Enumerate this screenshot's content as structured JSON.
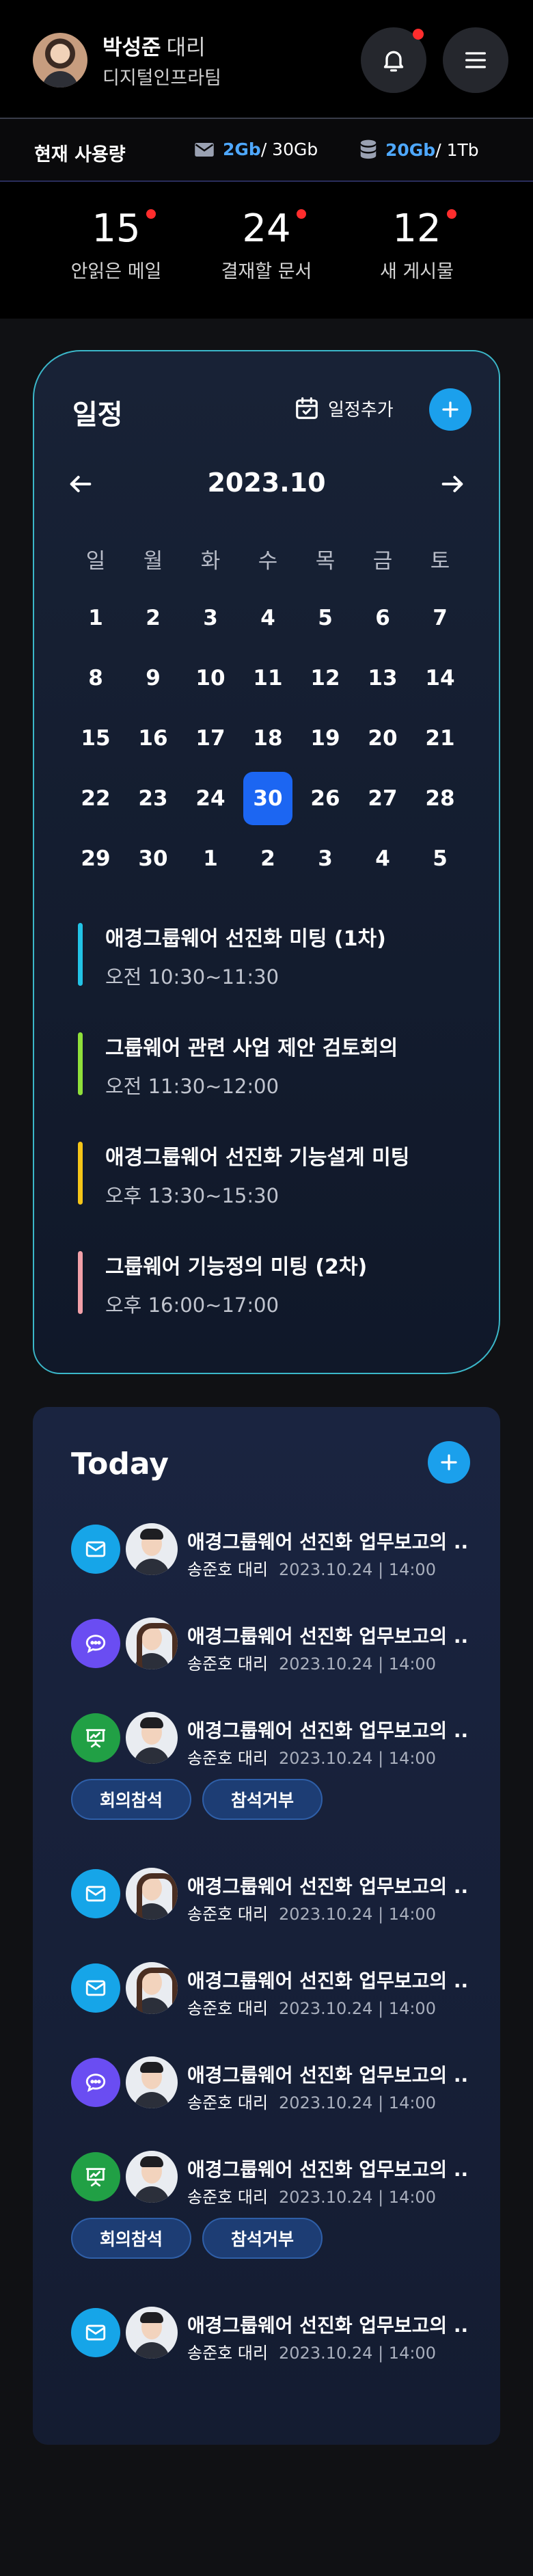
{
  "user": {
    "name": "박성준",
    "rank": "대리",
    "team": "디지털인프라팀"
  },
  "usage": {
    "title": "현재 사용량",
    "mail": {
      "used": "2Gb",
      "total": " / 30Gb",
      "icon": "mail-icon"
    },
    "db": {
      "used": "20Gb",
      "total": " / 1Tb",
      "icon": "database-icon"
    }
  },
  "counts": [
    {
      "value": "15",
      "label": "안읽은 메일"
    },
    {
      "value": "24",
      "label": "결재할 문서"
    },
    {
      "value": "12",
      "label": "새 게시물"
    }
  ],
  "schedule": {
    "title": "일정",
    "add_label": "일정추가",
    "month": "2023.10",
    "weekdays": [
      "일",
      "월",
      "화",
      "수",
      "목",
      "금",
      "토"
    ],
    "weeks": [
      [
        "1",
        "2",
        "3",
        "4",
        "5",
        "6",
        "7"
      ],
      [
        "8",
        "9",
        "10",
        "11",
        "12",
        "13",
        "14"
      ],
      [
        "15",
        "16",
        "17",
        "18",
        "19",
        "20",
        "21"
      ],
      [
        "22",
        "23",
        "24",
        "30",
        "26",
        "27",
        "28"
      ],
      [
        "29",
        "30",
        "1",
        "2",
        "3",
        "4",
        "5"
      ]
    ],
    "selected_day": "30",
    "events": [
      {
        "title": "애경그룹웨어 선진화 미팅 (1차)",
        "time": "오전 10:30~11:30",
        "color": "#22c3e6"
      },
      {
        "title": "그룹웨어 관련 사업 제안 검토회의",
        "time": "오전 11:30~12:00",
        "color": "#8fe03a"
      },
      {
        "title": "애경그룹웨어 선진화 기능설계 미팅",
        "time": "오후 13:30~15:30",
        "color": "#f5c518"
      },
      {
        "title": "그룹웨어 기능정의 미팅 (2차)",
        "time": "오후 16:00~17:00",
        "color": "#f2a0a8"
      }
    ]
  },
  "today": {
    "title": "Today",
    "items": [
      {
        "type": "mail",
        "title": "애경그룹웨어 선진화 업무보고의 ..",
        "person": "송준호 대리",
        "date": "2023.10.24",
        "time": "14:00"
      },
      {
        "type": "chat",
        "title": "애경그룹웨어 선진화 업무보고의 ..",
        "person": "송준호 대리",
        "date": "2023.10.24",
        "time": "14:00"
      },
      {
        "type": "present",
        "title": "애경그룹웨어 선진화 업무보고의 ..",
        "person": "송준호 대리",
        "date": "2023.10.24",
        "time": "14:00",
        "actions": [
          "회의참석",
          "참석거부"
        ]
      },
      {
        "type": "mail",
        "title": "애경그룹웨어 선진화 업무보고의 ..",
        "person": "송준호 대리",
        "date": "2023.10.24",
        "time": "14:00"
      },
      {
        "type": "mail",
        "title": "애경그룹웨어 선진화 업무보고의 ..",
        "person": "송준호 대리",
        "date": "2023.10.24",
        "time": "14:00"
      },
      {
        "type": "chat",
        "title": "애경그룹웨어 선진화 업무보고의 ..",
        "person": "송준호 대리",
        "date": "2023.10.24",
        "time": "14:00"
      },
      {
        "type": "present",
        "title": "애경그룹웨어 선진화 업무보고의 ..",
        "person": "송준호 대리",
        "date": "2023.10.24",
        "time": "14:00",
        "actions": [
          "회의참석",
          "참석거부"
        ]
      },
      {
        "type": "mail",
        "title": "애경그룹웨어 선진화 업무보고의 ..",
        "person": "송준호 대리",
        "date": "2023.10.24",
        "time": "14:00"
      }
    ]
  },
  "colors": {
    "accent": "#1ba0ec",
    "selected": "#1c66f2",
    "alert": "#ff2d2d"
  }
}
